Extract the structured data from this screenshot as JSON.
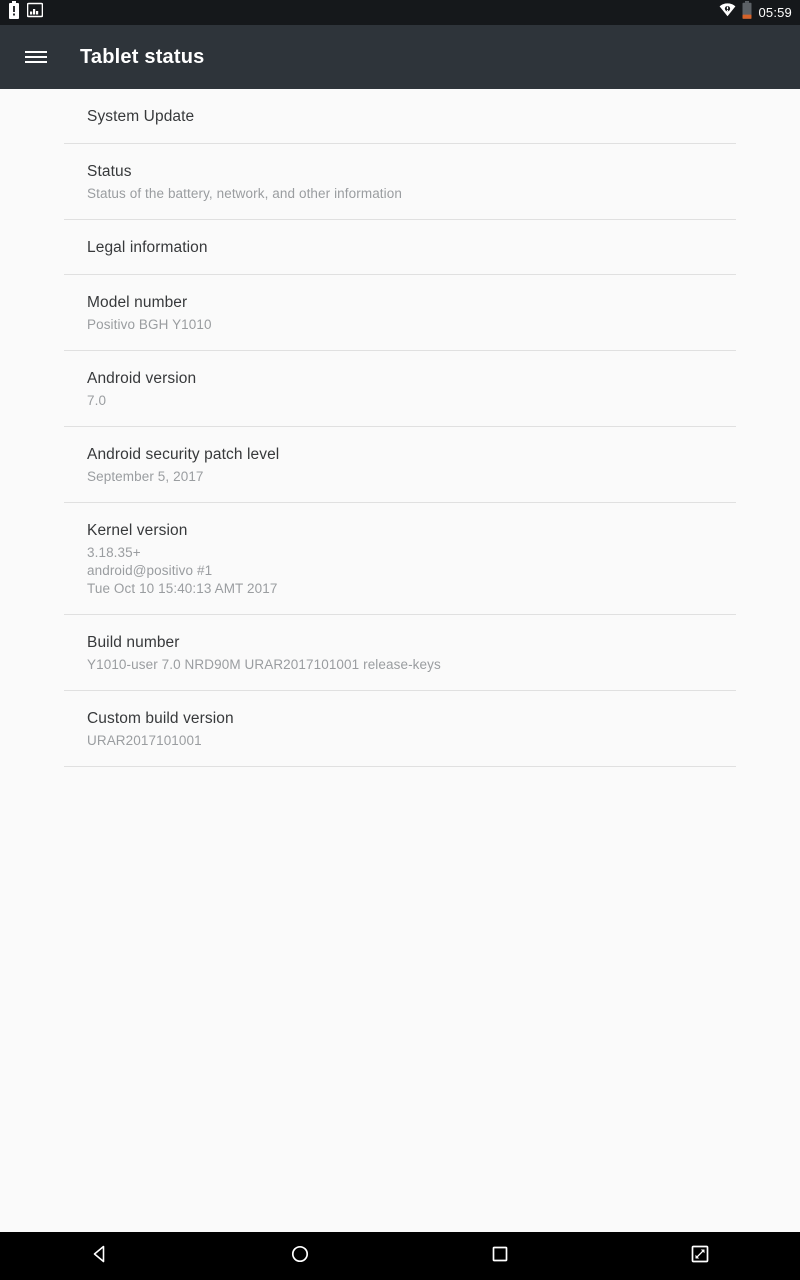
{
  "status_bar": {
    "left_icons": [
      {
        "name": "battery-alert-icon",
        "label": "battery-alert"
      },
      {
        "name": "screenshot-notification-icon",
        "label": "screenshot-image"
      }
    ],
    "right_icons": [
      {
        "name": "wifi-no-internet-icon",
        "label": "wifi-no-internet"
      },
      {
        "name": "battery-low-icon",
        "label": "battery-low"
      }
    ],
    "time": "05:59",
    "background_color": "#15181b",
    "battery_accent_color": "#d4622a"
  },
  "app_bar": {
    "title": "Tablet status",
    "menu_icon": "hamburger-menu-icon",
    "background_color": "#2e343a",
    "text_color": "#ffffff"
  },
  "list": {
    "rows": [
      {
        "title": "System Update",
        "summary": ""
      },
      {
        "title": "Status",
        "summary": "Status of the battery, network, and other information"
      },
      {
        "title": "Legal information",
        "summary": ""
      },
      {
        "title": "Model number",
        "summary": "Positivo BGH Y1010"
      },
      {
        "title": "Android version",
        "summary": "7.0"
      },
      {
        "title": "Android security patch level",
        "summary": "September 5, 2017"
      },
      {
        "title": "Kernel version",
        "summary": "3.18.35+\nandroid@positivo #1\nTue Oct 10 15:40:13 AMT 2017"
      },
      {
        "title": "Build number",
        "summary": "Y1010-user 7.0 NRD90M URAR2017101001 release-keys"
      },
      {
        "title": "Custom build version",
        "summary": "URAR2017101001"
      }
    ],
    "background_color": "#fafafa",
    "divider_color": "#e0e0e0",
    "title_color": "#37393b",
    "summary_color": "#9a9da0"
  },
  "nav_bar": {
    "buttons": [
      {
        "name": "nav-back-button",
        "label": "Back"
      },
      {
        "name": "nav-home-button",
        "label": "Home"
      },
      {
        "name": "nav-recents-button",
        "label": "Recent apps"
      },
      {
        "name": "nav-screenshot-button",
        "label": "Screenshot"
      }
    ],
    "background_color": "#000000"
  }
}
